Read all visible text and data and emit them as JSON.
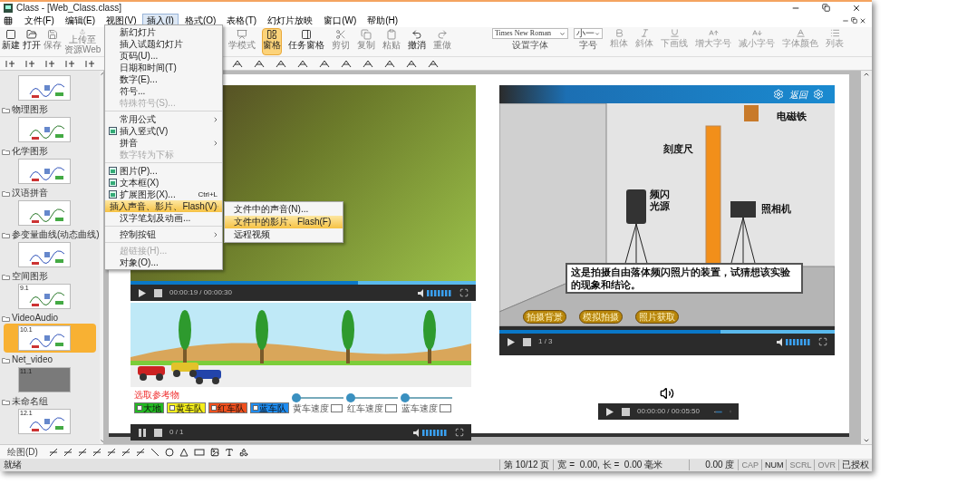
{
  "window": {
    "title": "Class - [Web_Class.class]"
  },
  "menu_bar": [
    {
      "label": "文件(F)",
      "selected": false
    },
    {
      "label": "编辑(E)",
      "selected": false
    },
    {
      "label": "视图(V)",
      "selected": false
    },
    {
      "label": "插入(I)",
      "selected": true
    },
    {
      "label": "格式(O)",
      "selected": false
    },
    {
      "label": "表格(T)",
      "selected": false
    },
    {
      "label": "幻灯片放映",
      "selected": false
    },
    {
      "label": "窗口(W)",
      "selected": false
    },
    {
      "label": "帮助(H)",
      "selected": false
    }
  ],
  "toolbar_left": [
    {
      "lines": [
        "新建"
      ],
      "disabled": false,
      "selected": false
    },
    {
      "lines": [
        "打开"
      ],
      "disabled": false,
      "selected": false
    },
    {
      "lines": [
        "保存"
      ],
      "disabled": true,
      "selected": false
    },
    {
      "lines": [
        "上传至",
        "资源Web"
      ],
      "disabled": true,
      "selected": false
    }
  ],
  "toolbar_right": [
    {
      "lines": [
        "学模式"
      ],
      "disabled": true,
      "selected": false
    },
    {
      "lines": [
        "窗格"
      ],
      "disabled": false,
      "selected": true
    },
    {
      "lines": [
        "任务窗格"
      ],
      "disabled": false,
      "selected": false
    },
    {
      "lines": [
        "剪切"
      ],
      "disabled": true,
      "selected": false
    },
    {
      "lines": [
        "复制"
      ],
      "disabled": true,
      "selected": false
    },
    {
      "lines": [
        "粘贴"
      ],
      "disabled": true,
      "selected": false
    },
    {
      "lines": [
        "撤消"
      ],
      "disabled": false,
      "selected": false
    },
    {
      "lines": [
        "重做"
      ],
      "disabled": true,
      "selected": false
    }
  ],
  "font_field": {
    "value": "Times New Roman",
    "caption": "设置字体"
  },
  "size_field": {
    "value": "小一",
    "caption": "字号"
  },
  "format_buttons": [
    {
      "label": "粗体",
      "disabled": true
    },
    {
      "label": "斜体",
      "disabled": true
    },
    {
      "label": "下画线",
      "disabled": true
    },
    {
      "label": "增大字号",
      "disabled": true
    },
    {
      "label": "减小字号",
      "disabled": true
    },
    {
      "label": "字体颜色",
      "disabled": true
    },
    {
      "label": "列表",
      "disabled": true
    }
  ],
  "insert_menu": [
    [
      {
        "label": "新幻灯片",
        "disabled": false,
        "selected": false,
        "submenu": false,
        "icon": false
      },
      {
        "label": "插入试题幻灯片",
        "disabled": false,
        "selected": false,
        "submenu": false,
        "icon": false
      },
      {
        "label": "页码(U)...",
        "disabled": false,
        "selected": false,
        "submenu": false,
        "icon": false
      },
      {
        "label": "日期和时间(T)",
        "disabled": false,
        "selected": false,
        "submenu": false,
        "icon": false
      },
      {
        "label": "数字(E)...",
        "disabled": false,
        "selected": false,
        "submenu": false,
        "icon": false
      },
      {
        "label": "符号...",
        "disabled": false,
        "selected": false,
        "submenu": false,
        "icon": false
      },
      {
        "label": "特殊符号(S)...",
        "disabled": true,
        "selected": false,
        "submenu": false,
        "icon": false
      }
    ],
    [
      {
        "label": "常用公式",
        "disabled": false,
        "selected": false,
        "submenu": true,
        "icon": false
      },
      {
        "label": "插入竖式(V)",
        "disabled": false,
        "selected": false,
        "submenu": false,
        "icon": true
      },
      {
        "label": "拼音",
        "disabled": false,
        "selected": false,
        "submenu": true,
        "icon": false
      },
      {
        "label": "数字转为下标",
        "disabled": true,
        "selected": false,
        "submenu": false,
        "icon": false
      }
    ],
    [
      {
        "label": "图片(P)...",
        "disabled": false,
        "selected": false,
        "submenu": false,
        "icon": true
      },
      {
        "label": "文本框(X)",
        "disabled": false,
        "selected": false,
        "submenu": false,
        "icon": true
      },
      {
        "label": "扩展图形(X)...",
        "shortcut": "Ctrl+L",
        "disabled": false,
        "selected": false,
        "submenu": false,
        "icon": true
      },
      {
        "label": "插入声音、影片、Flash(V)",
        "disabled": false,
        "selected": true,
        "submenu": true,
        "icon": false
      },
      {
        "label": "汉字笔划及动画...",
        "disabled": false,
        "selected": false,
        "submenu": false,
        "icon": false
      }
    ],
    [
      {
        "label": "控制按钮",
        "disabled": false,
        "selected": false,
        "submenu": true,
        "icon": false
      }
    ],
    [
      {
        "label": "超链接(H)...",
        "disabled": true,
        "selected": false,
        "submenu": false,
        "icon": false
      },
      {
        "label": "对象(O)...",
        "disabled": false,
        "selected": false,
        "submenu": false,
        "icon": false
      }
    ]
  ],
  "media_submenu": [
    {
      "label": "文件中的声音(N)...",
      "selected": false
    },
    {
      "label": "文件中的影片、Flash(F)",
      "selected": true
    },
    {
      "label": "远程视频",
      "selected": false
    }
  ],
  "sidebar": [
    {
      "selected": false
    },
    {
      "name": "物理图形",
      "selected": false
    },
    {
      "name": "化学图形",
      "selected": false
    },
    {
      "name": "汉语拼音",
      "selected": false
    },
    {
      "name": "参变量曲线(动态曲线)",
      "selected": false
    },
    {
      "name": "空间图形",
      "number": "9.1",
      "selected": false
    },
    {
      "name": "VideoAudio",
      "number": "10.1",
      "selected": true
    },
    {
      "name": "Net_video",
      "number": "11.1",
      "selected": false
    },
    {
      "name": "未命名组",
      "number": "12.1",
      "selected": false
    }
  ],
  "slide": {
    "video": {
      "time": "00:00:19 / 00:00:30",
      "level": 0.66,
      "playing": false
    },
    "animation": {
      "prompt": "选取参考物",
      "options": [
        {
          "label": "大地",
          "color": "#22b922",
          "checked": false
        },
        {
          "label": "黄车队",
          "color": "#f4ee1c",
          "checked": false
        },
        {
          "label": "红车队",
          "color": "#f0501e",
          "checked": false
        },
        {
          "label": "蓝车队",
          "color": "#1e8cf0",
          "checked": false
        }
      ],
      "sliders": [
        {
          "label": "黄车速度",
          "level": 0.08
        },
        {
          "label": "红车速度",
          "level": 0.08
        },
        {
          "label": "蓝车速度",
          "level": 0.08
        }
      ],
      "counter": "0 / 1",
      "playing": true
    },
    "flash": {
      "back": "返回",
      "labels": [
        "电磁铁",
        "刻度尺",
        "频闪光源",
        "照相机"
      ],
      "caption": "这是拍摄自由落体频闪照片的装置，试猜想该实验的现象和结论。",
      "buttons": [
        "拍摄背景",
        "模拟拍摄",
        "照片获取"
      ],
      "counter": "1 / 3",
      "level": 0.66,
      "playing": false
    },
    "audio": {
      "time": "00:00:00 / 00:05:50",
      "playing": false
    }
  },
  "draw_toolbar": {
    "label": "绘图(D)"
  },
  "status_bar": {
    "message": "就绪",
    "page": "第 10/12 页",
    "size": "宽 =  0.00, 长 =  0.00 毫米",
    "angle": "0.00 度",
    "keys": [
      {
        "label": "CAP",
        "on": false
      },
      {
        "label": "NUM",
        "on": true
      },
      {
        "label": "SCRL",
        "on": false
      },
      {
        "label": "OVR",
        "on": false
      }
    ],
    "license": "已授权"
  }
}
